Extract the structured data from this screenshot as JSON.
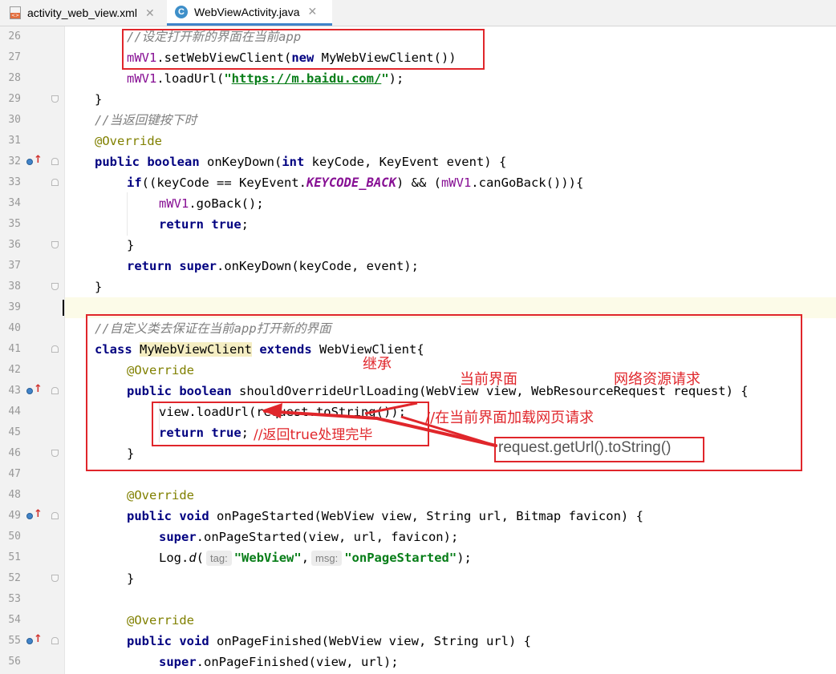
{
  "tabs": [
    {
      "label": "activity_web_view.xml",
      "active": false
    },
    {
      "label": "WebViewActivity.java",
      "active": true
    }
  ],
  "icons": {
    "xml": "xml-file-icon",
    "class": "java-class-icon",
    "close": "close-icon",
    "override": "override-marker-icon"
  },
  "colors": {
    "annotation": "#e0262b",
    "keyword": "#000080",
    "field": "#871094",
    "string": "#067d17"
  },
  "line_numbers": [
    "26",
    "27",
    "28",
    "29",
    "30",
    "31",
    "32",
    "33",
    "34",
    "35",
    "36",
    "37",
    "38",
    "39",
    "40",
    "41",
    "42",
    "43",
    "44",
    "45",
    "46",
    "47",
    "48",
    "49",
    "50",
    "51",
    "52",
    "53",
    "54",
    "55",
    "56"
  ],
  "code": {
    "l26": {
      "comment": "//设定打开新的界面在当前app"
    },
    "l27": {
      "field": "mWV1",
      "rest": ".setWebViewClient(",
      "kw_new": "new",
      "rest2": " MyWebViewClient())"
    },
    "l28": {
      "field": "mWV1",
      "rest": ".loadUrl(",
      "q1": "\"",
      "url": "https://m.baidu.com/",
      "q2": "\"",
      "end": ");"
    },
    "l29": {
      "text": "}"
    },
    "l30": {
      "comment": "//当返回键按下时"
    },
    "l31": {
      "annotation": "@Override"
    },
    "l32": {
      "kw_public": "public",
      "kw_boolean": "boolean",
      "rest": " onKeyDown(",
      "kw_int": "int",
      "rest2": " keyCode, KeyEvent event) {"
    },
    "l33": {
      "kw_if": "if",
      "p1": "((keyCode == KeyEvent.",
      "const": "KEYCODE_BACK",
      "p2": ") && (",
      "field": "mWV1",
      "p3": ".canGoBack())){"
    },
    "l34": {
      "field": "mWV1",
      "rest": ".goBack();"
    },
    "l35": {
      "kw_return": "return",
      "kw_true": "true",
      "end": ";"
    },
    "l36": {
      "text": "}"
    },
    "l37": {
      "kw_return": "return",
      "kw_super": "super",
      "rest": ".onKeyDown(keyCode, event);"
    },
    "l38": {
      "text": "}"
    },
    "l40": {
      "comment": "//自定义类去保证在当前app打开新的界面"
    },
    "l41": {
      "kw_class": "class",
      "name": "MyWebViewClient",
      "kw_extends": "extends",
      "rest": " WebViewClient{"
    },
    "l42": {
      "annotation": "@Override"
    },
    "l43": {
      "kw_public": "public",
      "kw_boolean": "boolean",
      "rest": " shouldOverrideUrlLoading(WebView view, WebResourceRequest request) {"
    },
    "l44": {
      "text": "view.loadUrl(request.toString());"
    },
    "l45": {
      "kw_return": "return",
      "kw_true": "true",
      "end": ";",
      "comment": "//返回true处理完毕"
    },
    "l46": {
      "text": "}"
    },
    "l48": {
      "annotation": "@Override"
    },
    "l49": {
      "kw_public": "public",
      "kw_void": "void",
      "rest": " onPageStarted(WebView view, String url, Bitmap favicon) {"
    },
    "l50": {
      "kw_super": "super",
      "rest": ".onPageStarted(view, url, favicon);"
    },
    "l51": {
      "pre": "Log.",
      "method": "d",
      "open": "(",
      "hint_tag": "tag:",
      "str1": "\"WebView\"",
      "comma": ",",
      "hint_msg": "msg:",
      "str2": "\"onPageStarted\"",
      "end": ");"
    },
    "l52": {
      "text": "}"
    },
    "l54": {
      "annotation": "@Override"
    },
    "l55": {
      "kw_public": "public",
      "kw_void": "void",
      "rest": " onPageFinished(WebView view, String url) {"
    },
    "l56": {
      "kw_super": "super",
      "rest": ".onPageFinished(view, url);"
    }
  },
  "annotations": {
    "inherit": "继承",
    "current_page": "当前界面",
    "network_request": "网络资源请求",
    "load_in_current": "//在当前界面加载网页请求",
    "request_url": "request.getUrl().toString()"
  }
}
